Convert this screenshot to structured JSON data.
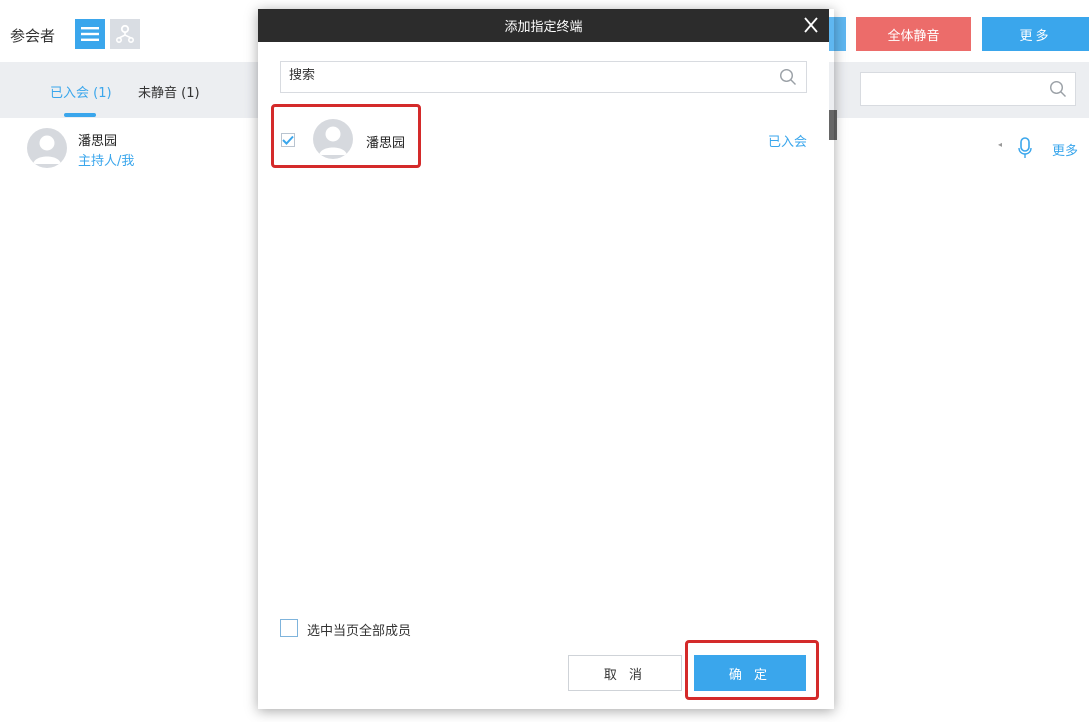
{
  "header": {
    "title": "参会者",
    "mute_all_label": "全体静音",
    "more_label": "更多"
  },
  "tabs": [
    {
      "label": "已入会 (1)"
    },
    {
      "label": "未静音 (1)"
    }
  ],
  "participants": [
    {
      "name": "潘思园",
      "role": "主持人/我",
      "more_label": "更多"
    }
  ],
  "modal": {
    "title": "添加指定终端",
    "search_placeholder": "搜索",
    "rows": [
      {
        "name": "潘思园",
        "status": "已入会",
        "checked": true
      }
    ],
    "select_all_label": "选中当页全部成员",
    "cancel_label": "取 消",
    "confirm_label": "确 定"
  },
  "colors": {
    "accent": "#3aa6ec",
    "danger": "#ec6c6a",
    "highlight": "#d42a2a",
    "modal_header": "#2c2c2c"
  },
  "icons": [
    "list-view-icon",
    "org-view-icon",
    "search-icon",
    "microphone-icon",
    "close-icon",
    "checkmark-icon",
    "avatar-icon"
  ]
}
